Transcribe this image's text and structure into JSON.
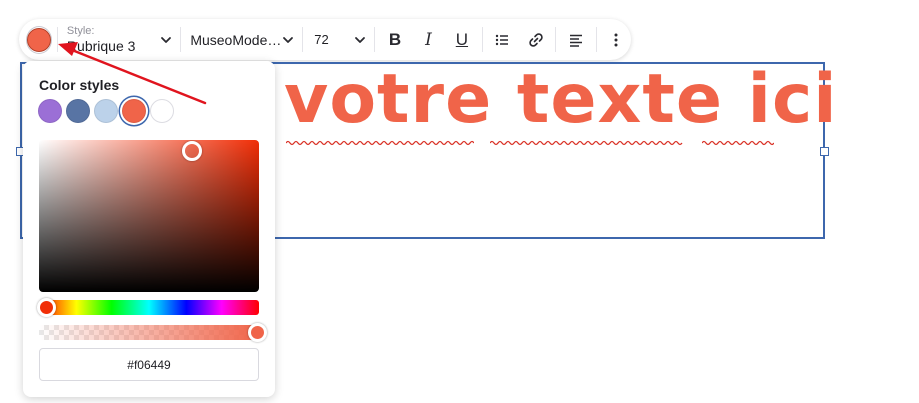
{
  "toolbar": {
    "text_color": "#f06449",
    "style_caption": "Style:",
    "style_value": "Rubrique 3",
    "font_value": "MuseoMode…",
    "size_value": "72",
    "icons": {
      "bold": "bold-icon",
      "italic": "italic-icon",
      "underline": "underline-icon",
      "list": "bulleted-list-icon",
      "link": "link-icon",
      "align": "align-left-icon",
      "more": "more-vertical-icon"
    },
    "bold_glyph": "B",
    "italic_glyph": "I",
    "underline_glyph": "U"
  },
  "canvas": {
    "headline": "votre texte ici",
    "frame_color": "#3d67ad"
  },
  "color_panel": {
    "title": "Color styles",
    "swatches": [
      "#9b6fd6",
      "#5874a4",
      "#bcd2ea",
      "#f06449",
      "#ffffff"
    ],
    "selected_swatch": "#f06449",
    "hue_color": "#f12e07",
    "hex_value": "#f06449",
    "alpha_percent": 100
  },
  "annotation": {
    "arrow_color": "#e0141e"
  }
}
